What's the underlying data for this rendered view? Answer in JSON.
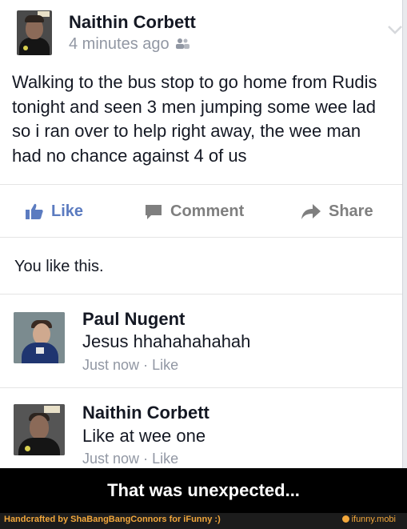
{
  "post": {
    "author": "Naithin Corbett",
    "timestamp": "4 minutes ago",
    "audience_icon": "friends-icon",
    "text": "Walking to the bus stop to go home from Rudis tonight and seen 3 men jumping some wee lad so i ran over to help right away, the wee man had no chance against 4 of us"
  },
  "actions": {
    "like": "Like",
    "comment": "Comment",
    "share": "Share"
  },
  "likes_summary": "You like this.",
  "comments": [
    {
      "author": "Paul Nugent",
      "text": "Jesus hhahahahahah",
      "time": "Just now",
      "separator": "·",
      "like": "Like"
    },
    {
      "author": "Naithin Corbett",
      "text": "Like at wee one",
      "time": "Just now",
      "separator": "·",
      "like": "Like"
    }
  ],
  "caption": "That was unexpected...",
  "footer": {
    "credit": "Handcrafted by ShaBangBangConnors for iFunny :)",
    "brand": "ifunny.mobi"
  },
  "colors": {
    "facebook_blue": "#5b7bc0",
    "meta_gray": "#9197a3",
    "ifunny_orange": "#f2a73b"
  }
}
